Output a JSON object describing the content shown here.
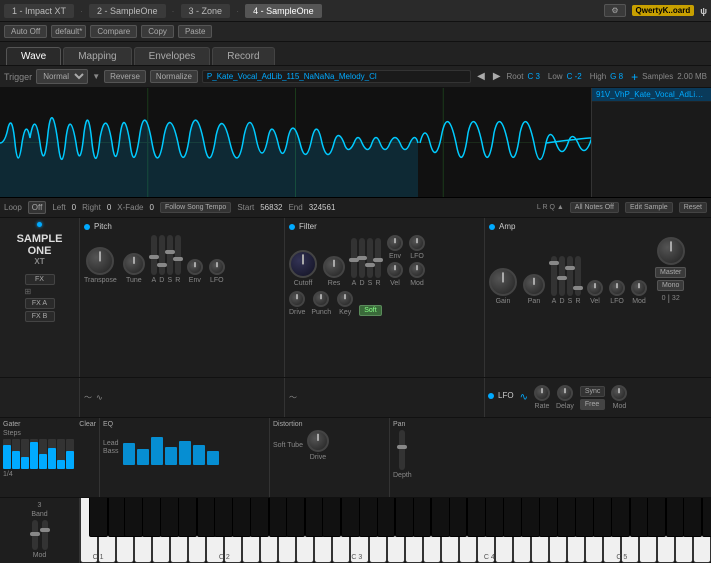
{
  "topbar": {
    "tabs": [
      {
        "label": "1 - Impact XT",
        "active": false
      },
      {
        "label": "2 - SampleOne",
        "active": false
      },
      {
        "label": "3 - Zone",
        "active": false
      },
      {
        "label": "4 - SampleOne",
        "active": true
      }
    ],
    "preset": "default*",
    "compare": "Compare",
    "copy": "Copy",
    "paste": "Paste",
    "qwerty": "QwertyK..oard",
    "settings_icon": "⚙"
  },
  "navtabs": {
    "tabs": [
      "Wave",
      "Mapping",
      "Envelopes",
      "Record"
    ],
    "active": "Wave"
  },
  "triggerbar": {
    "trigger_label": "Trigger",
    "mode": "Normal",
    "reverse": "Reverse",
    "normalize": "Normalize",
    "filename": "P_Kate_Vocal_AdLib_115_NaNaNa_Melody_Cl",
    "root_label": "Root",
    "root_val": "C 3",
    "low_label": "Low",
    "low_val": "C -2",
    "high_label": "High",
    "high_val": "G 8",
    "plus": "+",
    "samples_label": "Samples",
    "samples_size": "2.00 MB"
  },
  "waveform": {
    "sidebar_item": "91V_VhP_Kate_Vocal_AdLib_115..."
  },
  "loopbar": {
    "loop_label": "Loop",
    "loop_val": "Off",
    "left_label": "Left",
    "left_val": "0",
    "right_label": "Right",
    "right_val": "0",
    "xfade_label": "X-Fade",
    "xfade_val": "0",
    "follow": "Follow Song Tempo",
    "start_label": "Start",
    "start_val": "56832",
    "end_label": "End",
    "end_val": "324561",
    "all_notes": "All Notes Off",
    "edit": "Edit Sample",
    "reset": "Reset",
    "lrq": "L R Q ▲"
  },
  "pitch": {
    "title": "Pitch",
    "knobs": [
      {
        "label": "Transpose",
        "size": "lg"
      },
      {
        "label": "Tune",
        "size": "md"
      }
    ],
    "adsr": [
      "A",
      "D",
      "S",
      "R"
    ],
    "env_label": "Env",
    "lfo_label": "LFO"
  },
  "filter": {
    "title": "Filter",
    "cutoff_label": "Cutoff",
    "res_label": "Res",
    "adsr": [
      "A",
      "D",
      "S",
      "R"
    ],
    "env_label": "Env",
    "vel_label": "Vel",
    "lfo_label": "LFO",
    "mod_label": "Mod",
    "drive_label": "Drive",
    "punch_label": "Punch",
    "key_label": "Key",
    "soft_label": "Soft"
  },
  "amp": {
    "title": "Amp",
    "gain_label": "Gain",
    "pan_label": "Pan",
    "adsr": [
      "A",
      "D",
      "S",
      "R"
    ],
    "vel_label": "Vel",
    "lfo_label": "LFO",
    "mod_label": "Mod",
    "master_label": "Master",
    "mono_label": "Mono"
  },
  "lfo": {
    "title": "LFO",
    "rate_label": "Rate",
    "delay_label": "Delay",
    "sync_label": "Sync",
    "free_label": "Free",
    "mod_label": "Mod",
    "val": "0",
    "val2": "32"
  },
  "sampleone": {
    "logo_line1": "SAMPLE ONE",
    "logo_line2": "XT",
    "fx_label": "FX",
    "fxa_label": "FX A",
    "fxb_label": "FX B"
  },
  "gater": {
    "title": "Gater",
    "clear_label": "Clear",
    "steps_label": "Steps",
    "note_label": "1/4",
    "bars": [
      80,
      60,
      40,
      90,
      50,
      70,
      30,
      60
    ]
  },
  "eq": {
    "title": "EQ",
    "lead_label": "Lead",
    "bass_label": "Bass"
  },
  "distortion": {
    "title": "Distortion",
    "type_label": "Soft Tube",
    "drive_label": "Drive"
  },
  "pan_section": {
    "title": "Pan",
    "depth_label": "Depth"
  },
  "keyboard": {
    "band_label": "Band",
    "band_num": "3",
    "band_label2": "Band",
    "mod_label": "Mod",
    "c_labels": [
      "C 1",
      "C 2",
      "C 3",
      "C 4",
      "C 5"
    ],
    "num_white_keys": 35
  }
}
